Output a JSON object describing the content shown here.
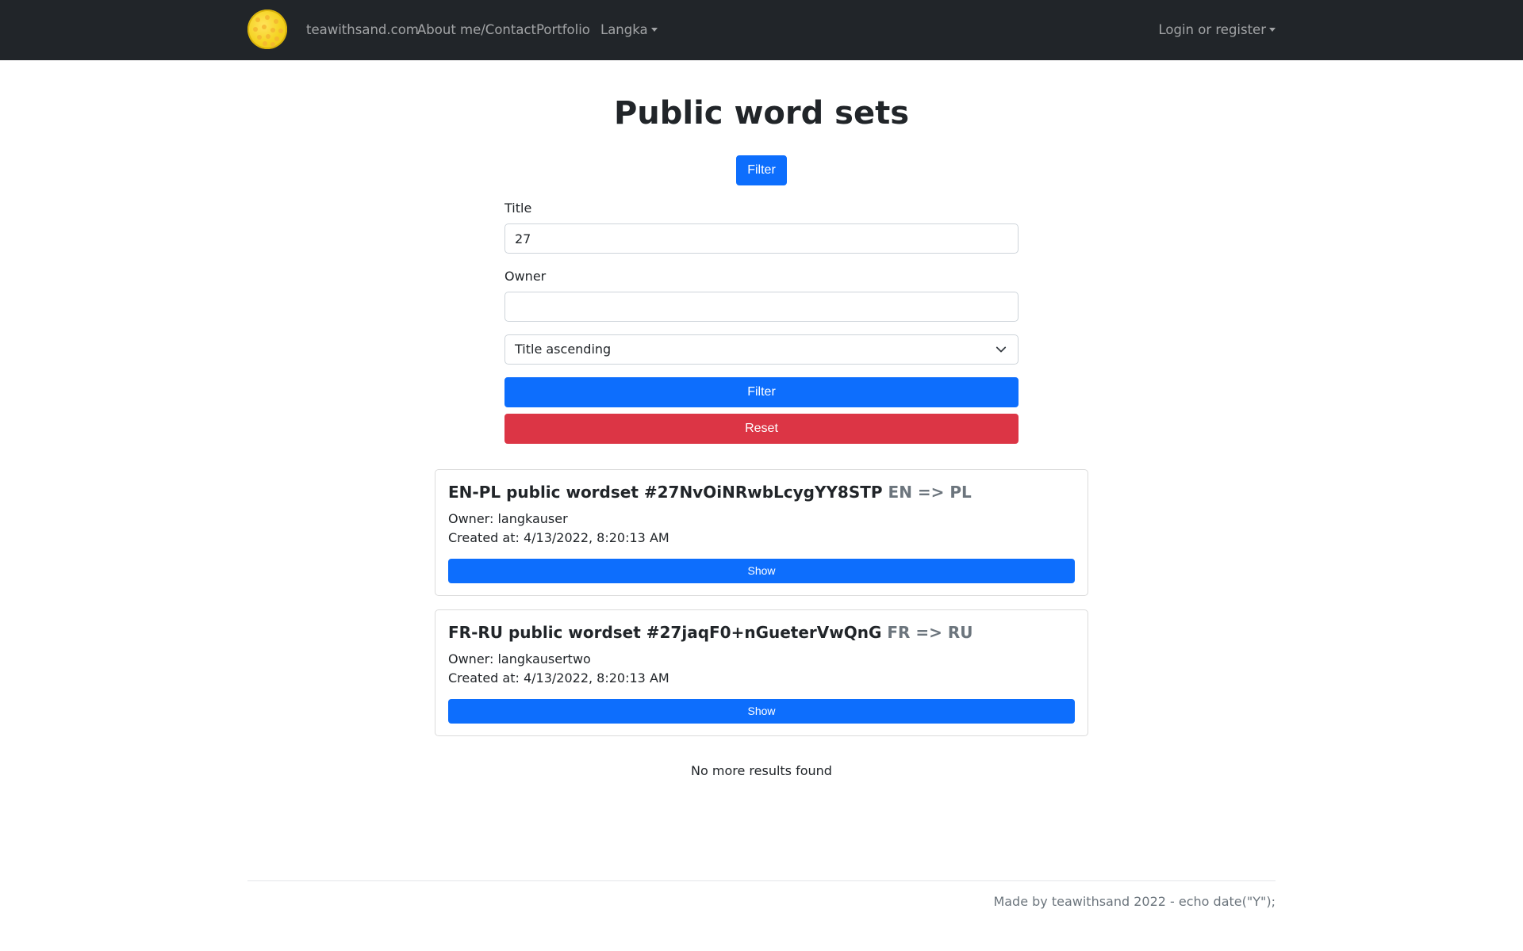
{
  "navbar": {
    "brand": "teawithsand.com",
    "links": [
      "About me/Contact",
      "Portfolio"
    ],
    "dropdown": "Langka",
    "login": "Login or register"
  },
  "page": {
    "title": "Public word sets",
    "filter_toggle": "Filter"
  },
  "form": {
    "title_label": "Title",
    "title_value": "27",
    "owner_label": "Owner",
    "owner_value": "",
    "sort_value": "Title ascending",
    "filter_button": "Filter",
    "reset_button": "Reset"
  },
  "results": [
    {
      "title": "EN-PL public wordset #27NvOiNRwbLcygYY8STP",
      "langs": "EN => PL",
      "owner": "Owner: langkauser",
      "created": "Created at: 4/13/2022, 8:20:13 AM",
      "button": "Show"
    },
    {
      "title": "FR-RU public wordset #27jaqF0+nGueterVwQnG",
      "langs": "FR => RU",
      "owner": "Owner: langkausertwo",
      "created": "Created at: 4/13/2022, 8:20:13 AM",
      "button": "Show"
    }
  ],
  "no_more": "No more results found",
  "footer": "Made by teawithsand 2022 - echo date(\"Y\");",
  "colors": {
    "navbar": "#212529",
    "primary": "#0d6efd",
    "danger": "#dc3545",
    "muted": "#6c757d",
    "logo": "#f4d21f"
  },
  "icons": {
    "logo": "yellow-dotted-circle-logo",
    "select": "chevron-down-icon",
    "dropdown": "caret-down-icon"
  }
}
